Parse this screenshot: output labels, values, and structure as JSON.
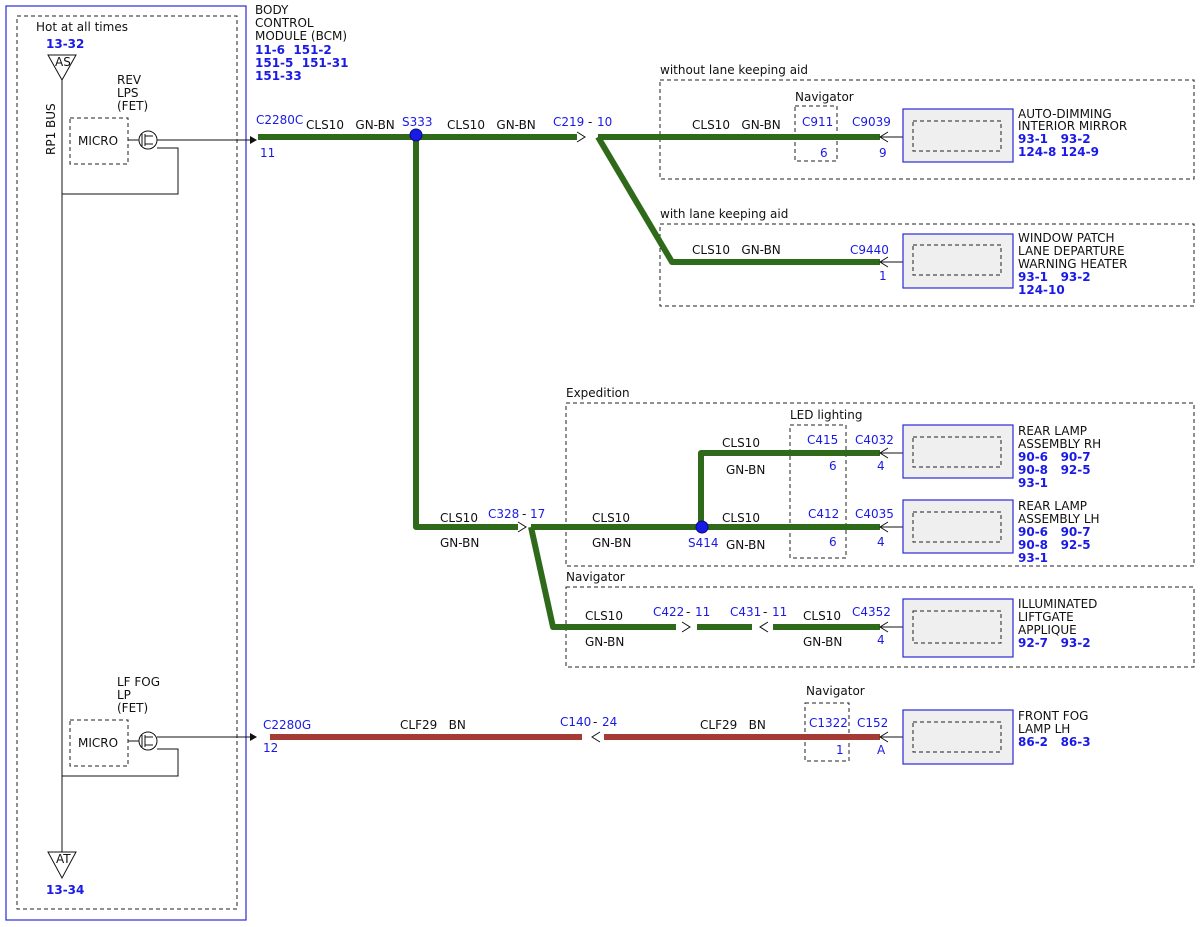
{
  "bcm": {
    "title_lines": [
      "BODY",
      "CONTROL",
      "MODULE (BCM)"
    ],
    "refs": [
      "11-6  151-2",
      "151-5  151-31",
      "151-33"
    ],
    "hot_label": "Hot at all times",
    "hot_ref": "13-32",
    "bus_label": "RP1 BUS",
    "triangle_top": "AS",
    "triangle_bottom": "AT",
    "bottom_ref": "13-34",
    "fet1_lines": [
      "REV",
      "LPS",
      "(FET)"
    ],
    "fet2_lines": [
      "LF FOG",
      "LP",
      "(FET)"
    ],
    "micro_label": "MICRO"
  },
  "connectors": {
    "c2280c": "C2280C",
    "c2280c_pin": "11",
    "s333": "S333",
    "c219": "C219",
    "c219_pin": "10",
    "c911": "C911",
    "c911_pin": "6",
    "c9039": "C9039",
    "c9039_pin": "9",
    "c9440": "C9440",
    "c9440_pin": "1",
    "c328": "C328",
    "c328_pin": "17",
    "s414": "S414",
    "c415": "C415",
    "c415_pin": "6",
    "c4032": "C4032",
    "c4032_pin": "4",
    "c412": "C412",
    "c412_pin": "6",
    "c4035": "C4035",
    "c4035_pin": "4",
    "c422": "C422",
    "c422_pin": "11",
    "c431": "C431",
    "c431_pin": "11",
    "c4352": "C4352",
    "c4352_pin": "4",
    "c2280g": "C2280G",
    "c2280g_pin": "12",
    "c140": "C140",
    "c140_pin": "24",
    "c1322": "C1322",
    "c1322_pin": "1",
    "c152": "C152",
    "c152_pin": "A"
  },
  "wires": {
    "cls10": "CLS10",
    "gnbn": "GN-BN",
    "cls10_gnbn": "CLS10   GN-BN",
    "clf29_bn": "CLF29   BN"
  },
  "groups": {
    "without_lka": "without lane keeping aid",
    "with_lka": "with lane keeping aid",
    "expedition": "Expedition",
    "led_lighting": "LED lighting",
    "navigator": "Navigator"
  },
  "components": {
    "mirror": {
      "lines": [
        "AUTO-DIMMING",
        "INTERIOR MIRROR"
      ],
      "refs": [
        "93-1   93-2",
        "124-8 124-9"
      ]
    },
    "window_patch": {
      "lines": [
        "WINDOW PATCH",
        "LANE DEPARTURE",
        "WARNING HEATER"
      ],
      "refs": [
        "93-1   93-2",
        "124-10"
      ]
    },
    "rear_rh": {
      "lines": [
        "REAR LAMP",
        "ASSEMBLY RH"
      ],
      "refs": [
        "90-6   90-7",
        "90-8   92-5",
        "93-1"
      ]
    },
    "rear_lh": {
      "lines": [
        "REAR LAMP",
        "ASSEMBLY LH"
      ],
      "refs": [
        "90-6   90-7",
        "90-8   92-5",
        "93-1"
      ]
    },
    "liftgate": {
      "lines": [
        "ILLUMINATED",
        "LIFTGATE",
        "APPLIQUE"
      ],
      "refs": [
        "92-7   93-2"
      ]
    },
    "fog": {
      "lines": [
        "FRONT FOG",
        "LAMP LH"
      ],
      "refs": [
        "86-2   86-3"
      ]
    }
  },
  "colors": {
    "wire_green": "#2f6a1b",
    "wire_red": "#a63a35",
    "connector_blue": "#1a1ae6"
  }
}
